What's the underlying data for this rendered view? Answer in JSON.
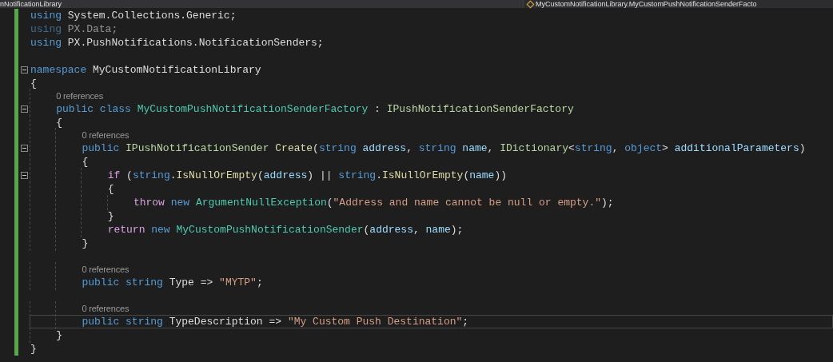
{
  "navigation_bar": {
    "project": "nNotificationLibrary",
    "member": "MyCustomNotificationLibrary.MyCustomPushNotificationSenderFacto"
  },
  "lines": [
    {
      "kind": "code",
      "changed": true,
      "tokens": [
        {
          "text": "using",
          "kind": "keyword"
        },
        {
          "text": " System.Collections.Generic;",
          "kind": "plain"
        }
      ]
    },
    {
      "kind": "code",
      "changed": true,
      "dimmed": true,
      "tokens": [
        {
          "text": "using",
          "kind": "keyword"
        },
        {
          "text": " PX.Data;",
          "kind": "plain"
        }
      ]
    },
    {
      "kind": "code",
      "changed": true,
      "tokens": [
        {
          "text": "using",
          "kind": "keyword"
        },
        {
          "text": " PX.PushNotifications.NotificationSenders;",
          "kind": "plain"
        }
      ]
    },
    {
      "kind": "blank",
      "changed": true
    },
    {
      "kind": "code",
      "changed": true,
      "expanded": true,
      "tokens": [
        {
          "text": "namespace",
          "kind": "keyword"
        },
        {
          "text": " MyCustomNotificationLibrary",
          "kind": "plain"
        }
      ]
    },
    {
      "kind": "code",
      "changed": true,
      "tokens": [
        {
          "text": "{",
          "kind": "plain"
        }
      ]
    },
    {
      "kind": "codelens",
      "changed": true,
      "text": "    0 references"
    },
    {
      "kind": "code",
      "changed": true,
      "expanded": true,
      "tokens": [
        {
          "text": "    public class ",
          "kind": "keyword"
        },
        {
          "text": "MyCustomPushNotificationSenderFactory",
          "kind": "type"
        },
        {
          "text": " : ",
          "kind": "plain"
        },
        {
          "text": "IPushNotificationSenderFactory",
          "kind": "interface"
        }
      ]
    },
    {
      "kind": "code",
      "changed": true,
      "tokens": [
        {
          "text": "    {",
          "kind": "plain"
        }
      ]
    },
    {
      "kind": "codelens",
      "changed": true,
      "text": "        0 references"
    },
    {
      "kind": "code",
      "changed": true,
      "expanded": true,
      "tokens": [
        {
          "text": "        public ",
          "kind": "keyword"
        },
        {
          "text": "IPushNotificationSender",
          "kind": "interface"
        },
        {
          "text": " Create",
          "kind": "method"
        },
        {
          "text": "(",
          "kind": "plain"
        },
        {
          "text": "string",
          "kind": "keyword"
        },
        {
          "text": " address",
          "kind": "param"
        },
        {
          "text": ", ",
          "kind": "plain"
        },
        {
          "text": "string",
          "kind": "keyword"
        },
        {
          "text": " name",
          "kind": "param"
        },
        {
          "text": ", ",
          "kind": "plain"
        },
        {
          "text": "IDictionary",
          "kind": "interface"
        },
        {
          "text": "<",
          "kind": "plain"
        },
        {
          "text": "string",
          "kind": "keyword"
        },
        {
          "text": ", ",
          "kind": "plain"
        },
        {
          "text": "object",
          "kind": "keyword"
        },
        {
          "text": "> ",
          "kind": "plain"
        },
        {
          "text": "additionalParameters",
          "kind": "param"
        },
        {
          "text": ")",
          "kind": "plain"
        }
      ]
    },
    {
      "kind": "code",
      "changed": true,
      "tokens": [
        {
          "text": "        {",
          "kind": "plain"
        }
      ]
    },
    {
      "kind": "code",
      "changed": true,
      "expanded": true,
      "tokens": [
        {
          "text": "            if",
          "kind": "control"
        },
        {
          "text": " (",
          "kind": "plain"
        },
        {
          "text": "string",
          "kind": "keyword"
        },
        {
          "text": ".",
          "kind": "plain"
        },
        {
          "text": "IsNullOrEmpty",
          "kind": "method"
        },
        {
          "text": "(",
          "kind": "plain"
        },
        {
          "text": "address",
          "kind": "param"
        },
        {
          "text": ") || ",
          "kind": "plain"
        },
        {
          "text": "string",
          "kind": "keyword"
        },
        {
          "text": ".",
          "kind": "plain"
        },
        {
          "text": "IsNullOrEmpty",
          "kind": "method"
        },
        {
          "text": "(",
          "kind": "plain"
        },
        {
          "text": "name",
          "kind": "param"
        },
        {
          "text": "))",
          "kind": "plain"
        }
      ]
    },
    {
      "kind": "code",
      "changed": true,
      "tokens": [
        {
          "text": "            {",
          "kind": "plain"
        }
      ]
    },
    {
      "kind": "code",
      "changed": true,
      "tokens": [
        {
          "text": "                throw",
          "kind": "control"
        },
        {
          "text": " new",
          "kind": "keyword"
        },
        {
          "text": " ArgumentNullException",
          "kind": "type"
        },
        {
          "text": "(",
          "kind": "plain"
        },
        {
          "text": "\"Address and name cannot be null or empty.\"",
          "kind": "string"
        },
        {
          "text": ");",
          "kind": "plain"
        }
      ]
    },
    {
      "kind": "code",
      "changed": true,
      "tokens": [
        {
          "text": "            }",
          "kind": "plain"
        }
      ]
    },
    {
      "kind": "code",
      "changed": true,
      "tokens": [
        {
          "text": "            return",
          "kind": "control"
        },
        {
          "text": " new",
          "kind": "keyword"
        },
        {
          "text": " MyCustomPushNotificationSender",
          "kind": "type"
        },
        {
          "text": "(",
          "kind": "plain"
        },
        {
          "text": "address",
          "kind": "param"
        },
        {
          "text": ", ",
          "kind": "plain"
        },
        {
          "text": "name",
          "kind": "param"
        },
        {
          "text": ");",
          "kind": "plain"
        }
      ]
    },
    {
      "kind": "code",
      "changed": true,
      "tokens": [
        {
          "text": "        }",
          "kind": "plain"
        }
      ]
    },
    {
      "kind": "blank",
      "changed": true
    },
    {
      "kind": "codelens",
      "changed": true,
      "text": "        0 references"
    },
    {
      "kind": "code",
      "changed": true,
      "tokens": [
        {
          "text": "        public string ",
          "kind": "keyword"
        },
        {
          "text": "Type => ",
          "kind": "plain"
        },
        {
          "text": "\"MYTP\"",
          "kind": "string"
        },
        {
          "text": ";",
          "kind": "plain"
        }
      ]
    },
    {
      "kind": "blank",
      "changed": true
    },
    {
      "kind": "codelens",
      "changed": true,
      "text": "        0 references"
    },
    {
      "kind": "code",
      "changed": true,
      "current": true,
      "tokens": [
        {
          "text": "        public string ",
          "kind": "keyword"
        },
        {
          "text": "TypeDescription => ",
          "kind": "plain"
        },
        {
          "text": "\"My Custom Push Destination\"",
          "kind": "string"
        },
        {
          "text": ";",
          "kind": "plain"
        }
      ]
    },
    {
      "kind": "code",
      "changed": true,
      "tokens": [
        {
          "text": "    }",
          "kind": "plain"
        }
      ]
    },
    {
      "kind": "code",
      "changed": true,
      "tokens": [
        {
          "text": "}",
          "kind": "plain"
        }
      ]
    }
  ]
}
